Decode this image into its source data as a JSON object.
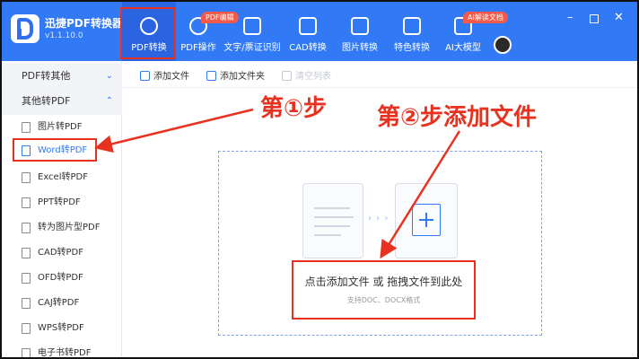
{
  "app": {
    "name": "迅捷PDF转换器",
    "version": "v1.1.10.0"
  },
  "nav": [
    {
      "label": "PDF转换",
      "active": true,
      "badge": ""
    },
    {
      "label": "PDF操作",
      "active": false,
      "badge": "PDF编辑"
    },
    {
      "label": "文字/票证识别",
      "active": false,
      "badge": ""
    },
    {
      "label": "CAD转换",
      "active": false,
      "badge": ""
    },
    {
      "label": "图片转换",
      "active": false,
      "badge": ""
    },
    {
      "label": "特色转换",
      "active": false,
      "badge": ""
    },
    {
      "label": "AI大模型",
      "active": false,
      "badge": "AI解读文档"
    }
  ],
  "window_controls": {
    "minimize": "–",
    "close": "✕"
  },
  "sidebar": {
    "group1": "PDF转其他",
    "group2": "其他转PDF",
    "items": [
      {
        "label": "图片转PDF"
      },
      {
        "label": "Word转PDF"
      },
      {
        "label": "Excel转PDF"
      },
      {
        "label": "PPT转PDF"
      },
      {
        "label": "转为图片型PDF"
      },
      {
        "label": "CAD转PDF"
      },
      {
        "label": "OFD转PDF"
      },
      {
        "label": "CAJ转PDF"
      },
      {
        "label": "WPS转PDF"
      },
      {
        "label": "电子书转PDF"
      }
    ]
  },
  "toolbar": {
    "add_file": "添加文件",
    "add_folder": "添加文件夹",
    "clear_list": "清空列表"
  },
  "dropzone": {
    "hint": "点击添加文件 或 拖拽文件到此处",
    "formats": "支持DOC、DOCX格式",
    "arrows": "› › ›"
  },
  "annotations": {
    "step1": "第①步",
    "step2": "第②步添加文件"
  },
  "colors": {
    "brand": "#3279f6",
    "annotation": "#e8321f"
  }
}
